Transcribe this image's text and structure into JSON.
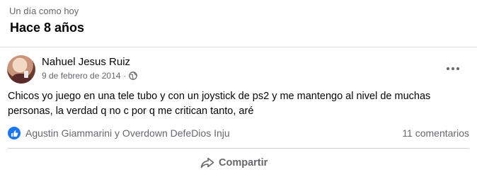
{
  "memory": {
    "eyebrow": "Un día como hoy",
    "title": "Hace 8 años"
  },
  "post": {
    "author": "Nahuel Jesus Ruiz",
    "date": "9 de febrero de 2014",
    "separator": "·",
    "audience_icon": "globe-icon",
    "text": "Chicos yo juego en una tele tubo y con un joystick de ps2 y me mantengo al nivel de muchas personas, la verdad q no c por q me critican tanto, aré",
    "reactions": {
      "icon": "like-icon",
      "names": "Agustin Giammarini y Overdown DefeDios Inju"
    },
    "comments": "11 comentarios",
    "share_label": "Compartir"
  },
  "colors": {
    "primary_text": "#050505",
    "secondary_text": "#65676b",
    "like_blue": "#1877f2",
    "divider": "#dadde1"
  }
}
